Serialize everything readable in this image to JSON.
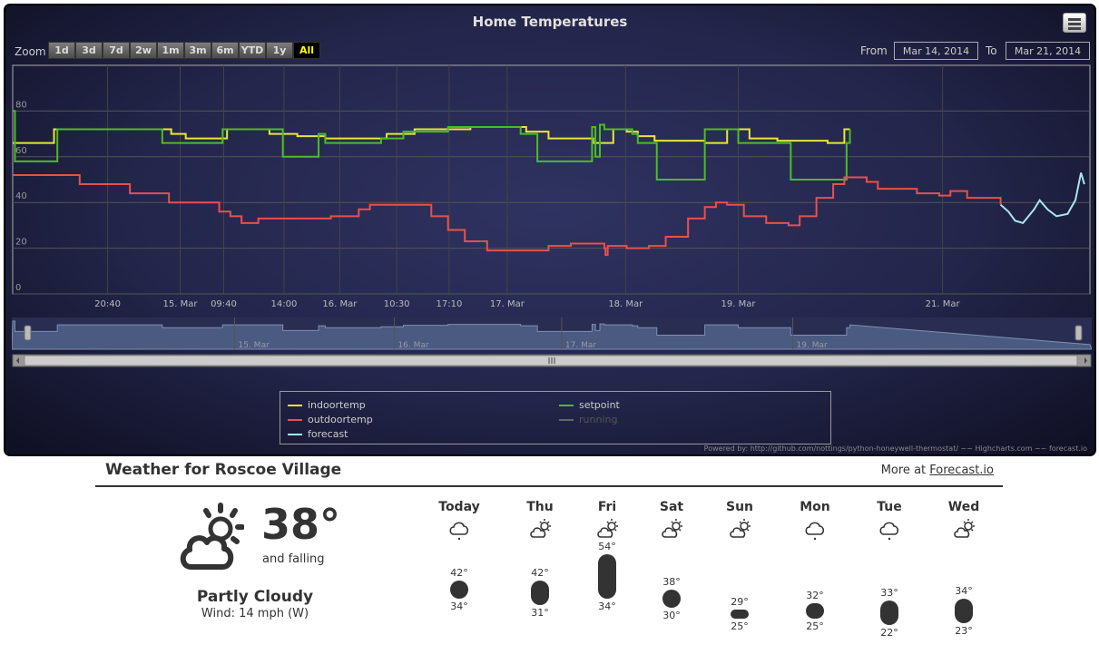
{
  "chart": {
    "title": "Home Temperatures",
    "zoom_label": "Zoom",
    "zoom_buttons": [
      "1d",
      "3d",
      "7d",
      "2w",
      "1m",
      "3m",
      "6m",
      "YTD",
      "1y",
      "All"
    ],
    "active_zoom": "All",
    "from_label": "From",
    "from_value": "Mar 14, 2014",
    "to_label": "To",
    "to_value": "Mar 21, 2014",
    "credits": "Powered by: http://github.com/nottings/python-honeywell-thermostat/ ~~ Highcharts.com ~~ forecast.io",
    "legend": [
      {
        "name": "indoortemp",
        "color": "#e8e63a",
        "active": true
      },
      {
        "name": "setpoint",
        "color": "#4bbd24",
        "active": true
      },
      {
        "name": "outdoortemp",
        "color": "#e8504e",
        "active": true
      },
      {
        "name": "running",
        "color": "#666666",
        "active": false
      },
      {
        "name": "forecast",
        "color": "#a8e6ee",
        "active": true
      }
    ],
    "navigator_labels": [
      "15. Mar",
      "16. Mar",
      "17. Mar",
      "19. Mar"
    ]
  },
  "chart_data": {
    "type": "line",
    "title": "Home Temperatures",
    "x_unit": "day",
    "x_range": [
      "2014-03-14 12:00",
      "2014-03-21 12:00"
    ],
    "x_ticks": [
      {
        "t": 0.85,
        "label": "20:40"
      },
      {
        "t": 1.5,
        "label": "15. Mar"
      },
      {
        "t": 1.89,
        "label": "09:40"
      },
      {
        "t": 2.43,
        "label": "14:00"
      },
      {
        "t": 2.93,
        "label": "16. Mar"
      },
      {
        "t": 3.44,
        "label": "10:30"
      },
      {
        "t": 3.91,
        "label": "17:10"
      },
      {
        "t": 4.43,
        "label": "17. Mar"
      },
      {
        "t": 5.49,
        "label": "18. Mar"
      },
      {
        "t": 6.5,
        "label": "19. Mar"
      },
      {
        "t": 8.33,
        "label": "21. Mar"
      }
    ],
    "ylim": [
      0,
      100
    ],
    "y_ticks": [
      0,
      20,
      40,
      60,
      80
    ],
    "grid": true,
    "legend_position": "bottom",
    "series": [
      {
        "name": "indoortemp",
        "color": "#e8e63a",
        "points": [
          [
            0,
            66
          ],
          [
            0.35,
            66
          ],
          [
            0.37,
            72
          ],
          [
            1.35,
            72
          ],
          [
            1.42,
            70
          ],
          [
            1.55,
            68
          ],
          [
            1.9,
            68
          ],
          [
            1.92,
            72
          ],
          [
            2.25,
            72
          ],
          [
            2.3,
            70
          ],
          [
            2.55,
            69
          ],
          [
            2.8,
            68
          ],
          [
            3.25,
            68
          ],
          [
            3.35,
            70
          ],
          [
            3.6,
            72
          ],
          [
            4.1,
            73
          ],
          [
            4.5,
            73
          ],
          [
            4.6,
            71
          ],
          [
            4.8,
            68
          ],
          [
            5.2,
            66
          ],
          [
            5.35,
            66
          ],
          [
            5.38,
            72
          ],
          [
            5.5,
            71
          ],
          [
            5.6,
            69
          ],
          [
            5.75,
            67
          ],
          [
            6.2,
            66
          ],
          [
            6.35,
            66
          ],
          [
            6.4,
            72
          ],
          [
            6.6,
            68
          ],
          [
            6.85,
            67
          ],
          [
            7.3,
            66
          ],
          [
            7.42,
            66
          ],
          [
            7.45,
            72
          ],
          [
            7.5,
            72
          ]
        ]
      },
      {
        "name": "setpoint",
        "color": "#4bbd24",
        "points": [
          [
            0,
            80
          ],
          [
            0.02,
            58
          ],
          [
            0.38,
            58
          ],
          [
            0.4,
            72
          ],
          [
            1.32,
            72
          ],
          [
            1.34,
            66
          ],
          [
            1.86,
            66
          ],
          [
            1.88,
            72
          ],
          [
            2.4,
            72
          ],
          [
            2.42,
            60
          ],
          [
            2.72,
            60
          ],
          [
            2.74,
            70
          ],
          [
            2.76,
            70
          ],
          [
            2.8,
            66
          ],
          [
            3.3,
            68
          ],
          [
            3.5,
            71
          ],
          [
            3.9,
            73
          ],
          [
            4.5,
            73
          ],
          [
            4.55,
            70
          ],
          [
            4.7,
            58
          ],
          [
            5.17,
            58
          ],
          [
            5.19,
            73
          ],
          [
            5.22,
            60
          ],
          [
            5.26,
            74
          ],
          [
            5.3,
            72
          ],
          [
            5.55,
            70
          ],
          [
            5.6,
            66
          ],
          [
            5.75,
            66
          ],
          [
            5.77,
            50
          ],
          [
            6.15,
            50
          ],
          [
            6.2,
            72
          ],
          [
            6.45,
            72
          ],
          [
            6.5,
            66
          ],
          [
            6.95,
            66
          ],
          [
            6.97,
            50
          ],
          [
            7.45,
            50
          ],
          [
            7.47,
            66
          ],
          [
            7.5,
            72
          ]
        ]
      },
      {
        "name": "outdoortemp",
        "color": "#e8504e",
        "points": [
          [
            0,
            52
          ],
          [
            0.45,
            52
          ],
          [
            0.6,
            48
          ],
          [
            1.05,
            44
          ],
          [
            1.4,
            40
          ],
          [
            1.65,
            40
          ],
          [
            1.85,
            36
          ],
          [
            1.95,
            34
          ],
          [
            2.05,
            31
          ],
          [
            2.2,
            33
          ],
          [
            2.6,
            33
          ],
          [
            2.85,
            34
          ],
          [
            3.1,
            37
          ],
          [
            3.2,
            39
          ],
          [
            3.5,
            39
          ],
          [
            3.75,
            34
          ],
          [
            3.9,
            28
          ],
          [
            4.05,
            23
          ],
          [
            4.25,
            19
          ],
          [
            4.6,
            19
          ],
          [
            4.8,
            21
          ],
          [
            5.0,
            22
          ],
          [
            5.2,
            22
          ],
          [
            5.3,
            20
          ],
          [
            5.31,
            17
          ],
          [
            5.33,
            21
          ],
          [
            5.5,
            20
          ],
          [
            5.7,
            21
          ],
          [
            5.85,
            25
          ],
          [
            6.05,
            33
          ],
          [
            6.2,
            38
          ],
          [
            6.3,
            40
          ],
          [
            6.4,
            39
          ],
          [
            6.55,
            34
          ],
          [
            6.75,
            31
          ],
          [
            6.95,
            30
          ],
          [
            7.05,
            34
          ],
          [
            7.2,
            42
          ],
          [
            7.35,
            48
          ],
          [
            7.45,
            51
          ],
          [
            7.55,
            51
          ],
          [
            7.65,
            49
          ],
          [
            7.75,
            46
          ],
          [
            8.0,
            46
          ],
          [
            8.1,
            44
          ],
          [
            8.3,
            43
          ],
          [
            8.4,
            45
          ],
          [
            8.55,
            42
          ],
          [
            8.85,
            39
          ]
        ]
      },
      {
        "name": "forecast",
        "color": "#a8e6ee",
        "points": [
          [
            8.85,
            39
          ],
          [
            8.92,
            36
          ],
          [
            8.98,
            32
          ],
          [
            9.05,
            31
          ],
          [
            9.15,
            37
          ],
          [
            9.2,
            41
          ],
          [
            9.27,
            37
          ],
          [
            9.35,
            34
          ],
          [
            9.45,
            35
          ],
          [
            9.52,
            41
          ],
          [
            9.57,
            53
          ],
          [
            9.6,
            48
          ]
        ]
      }
    ]
  },
  "weather": {
    "title": "Weather for Roscoe Village",
    "more_prefix": "More at",
    "more_link": "Forecast.io",
    "current": {
      "icon": "partly-cloudy-day-icon",
      "temp": "38°",
      "trend": "and falling",
      "summary": "Partly Cloudy",
      "wind": "Wind: 14 mph (W)"
    },
    "days": [
      {
        "name": "Today",
        "icon": "drizzle-icon",
        "hi": "42°",
        "lo": "34°",
        "hi_v": 42,
        "lo_v": 34
      },
      {
        "name": "Thu",
        "icon": "partly-cloudy-day-icon",
        "hi": "42°",
        "lo": "31°",
        "hi_v": 42,
        "lo_v": 31
      },
      {
        "name": "Fri",
        "icon": "partly-cloudy-day-icon",
        "hi": "54°",
        "lo": "34°",
        "hi_v": 54,
        "lo_v": 34
      },
      {
        "name": "Sat",
        "icon": "partly-cloudy-day-icon",
        "hi": "38°",
        "lo": "30°",
        "hi_v": 38,
        "lo_v": 30
      },
      {
        "name": "Sun",
        "icon": "partly-cloudy-day-icon",
        "hi": "29°",
        "lo": "25°",
        "hi_v": 29,
        "lo_v": 25
      },
      {
        "name": "Mon",
        "icon": "drizzle-icon",
        "hi": "32°",
        "lo": "25°",
        "hi_v": 32,
        "lo_v": 25
      },
      {
        "name": "Tue",
        "icon": "drizzle-icon",
        "hi": "33°",
        "lo": "22°",
        "hi_v": 33,
        "lo_v": 22
      },
      {
        "name": "Wed",
        "icon": "partly-cloudy-day-icon",
        "hi": "34°",
        "lo": "23°",
        "hi_v": 34,
        "lo_v": 23
      }
    ]
  }
}
